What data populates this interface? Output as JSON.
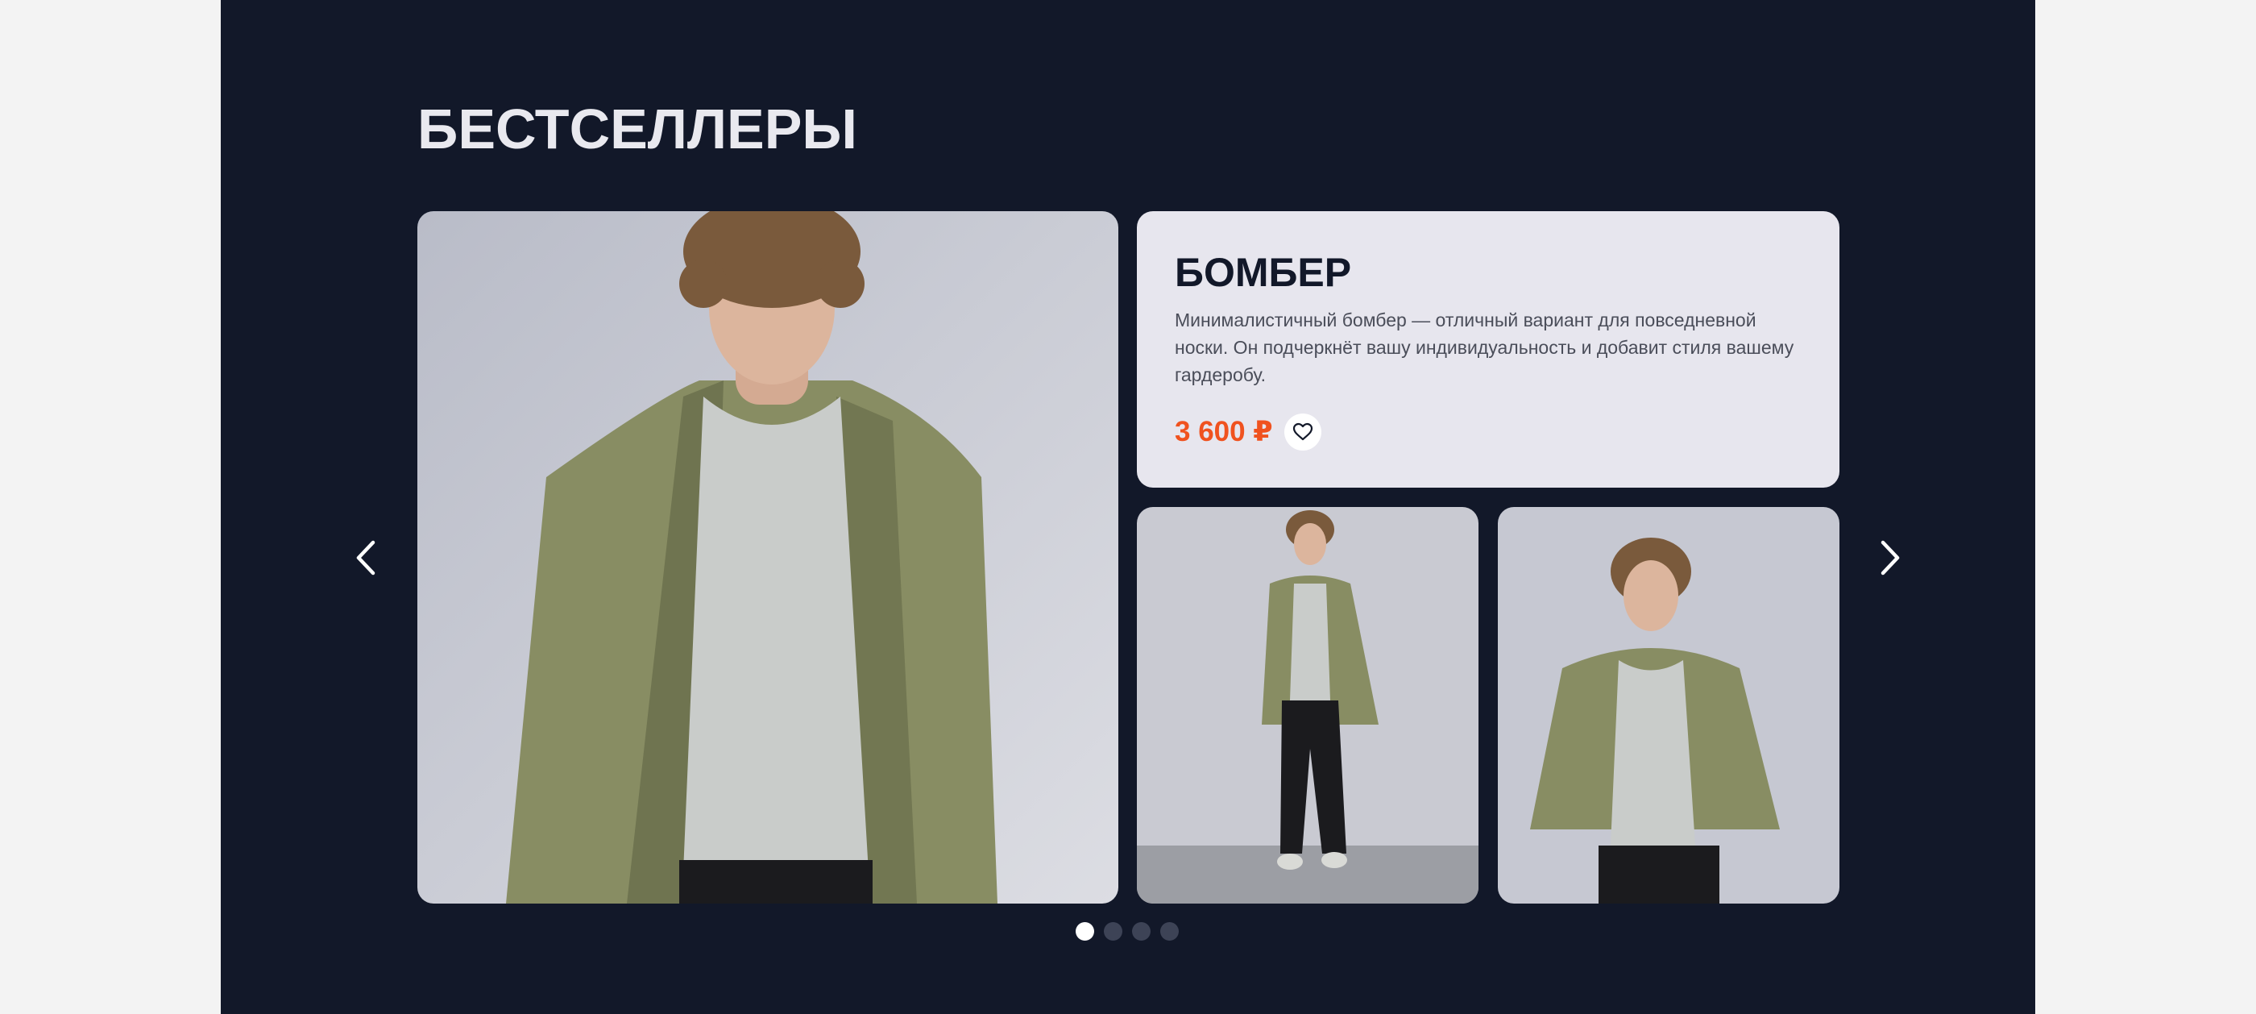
{
  "section": {
    "title": "БЕСТСЕЛЛЕРЫ"
  },
  "product": {
    "name": "БОМБЕР",
    "description": "Минималистичный бомбер — отличный вариант для повседневной носки. Он подчеркнёт вашу индивидуальность и добавит стиля вашему гардеробу.",
    "price": "3 600 ₽",
    "favorite_icon": "heart-icon"
  },
  "gallery": {
    "images": [
      {
        "name": "product-photo-main",
        "depicts": "model-closeup"
      },
      {
        "name": "product-photo-full-length",
        "depicts": "model-full-length"
      },
      {
        "name": "product-photo-half-length",
        "depicts": "model-half-length"
      }
    ]
  },
  "carousel": {
    "prev_icon": "chevron-left-icon",
    "next_icon": "chevron-right-icon",
    "dots_count": 4,
    "active_dot": 0
  },
  "colors": {
    "background": "#121829",
    "page": "#f3f3f3",
    "card": "#e7e6ee",
    "price": "#f0521f",
    "text_dark": "#121829",
    "dot_inactive": "#3d4356"
  }
}
